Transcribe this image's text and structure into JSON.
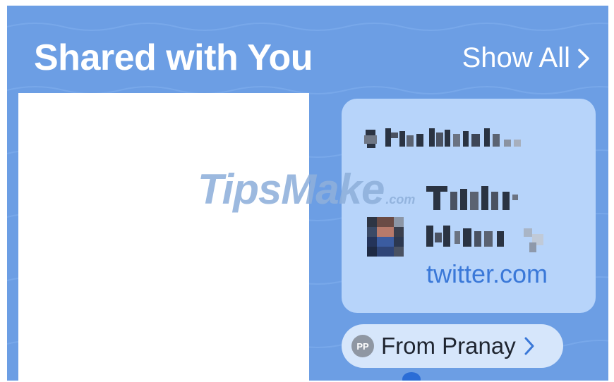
{
  "section": {
    "title": "Shared with You",
    "show_all_label": "Show All",
    "show_all_icon": "chevron-right-icon"
  },
  "card": {
    "domain": "twitter.com",
    "avatar_icon": "profile-avatar-icon"
  },
  "from": {
    "initials": "PP",
    "label": "From Pranay",
    "chevron_icon": "chevron-right-icon"
  },
  "watermark": {
    "brand": "TipsMake",
    "suffix": ".com"
  },
  "colors": {
    "background": "#6c9ee4",
    "card": "#b7d4fa",
    "link": "#3a78d8"
  }
}
